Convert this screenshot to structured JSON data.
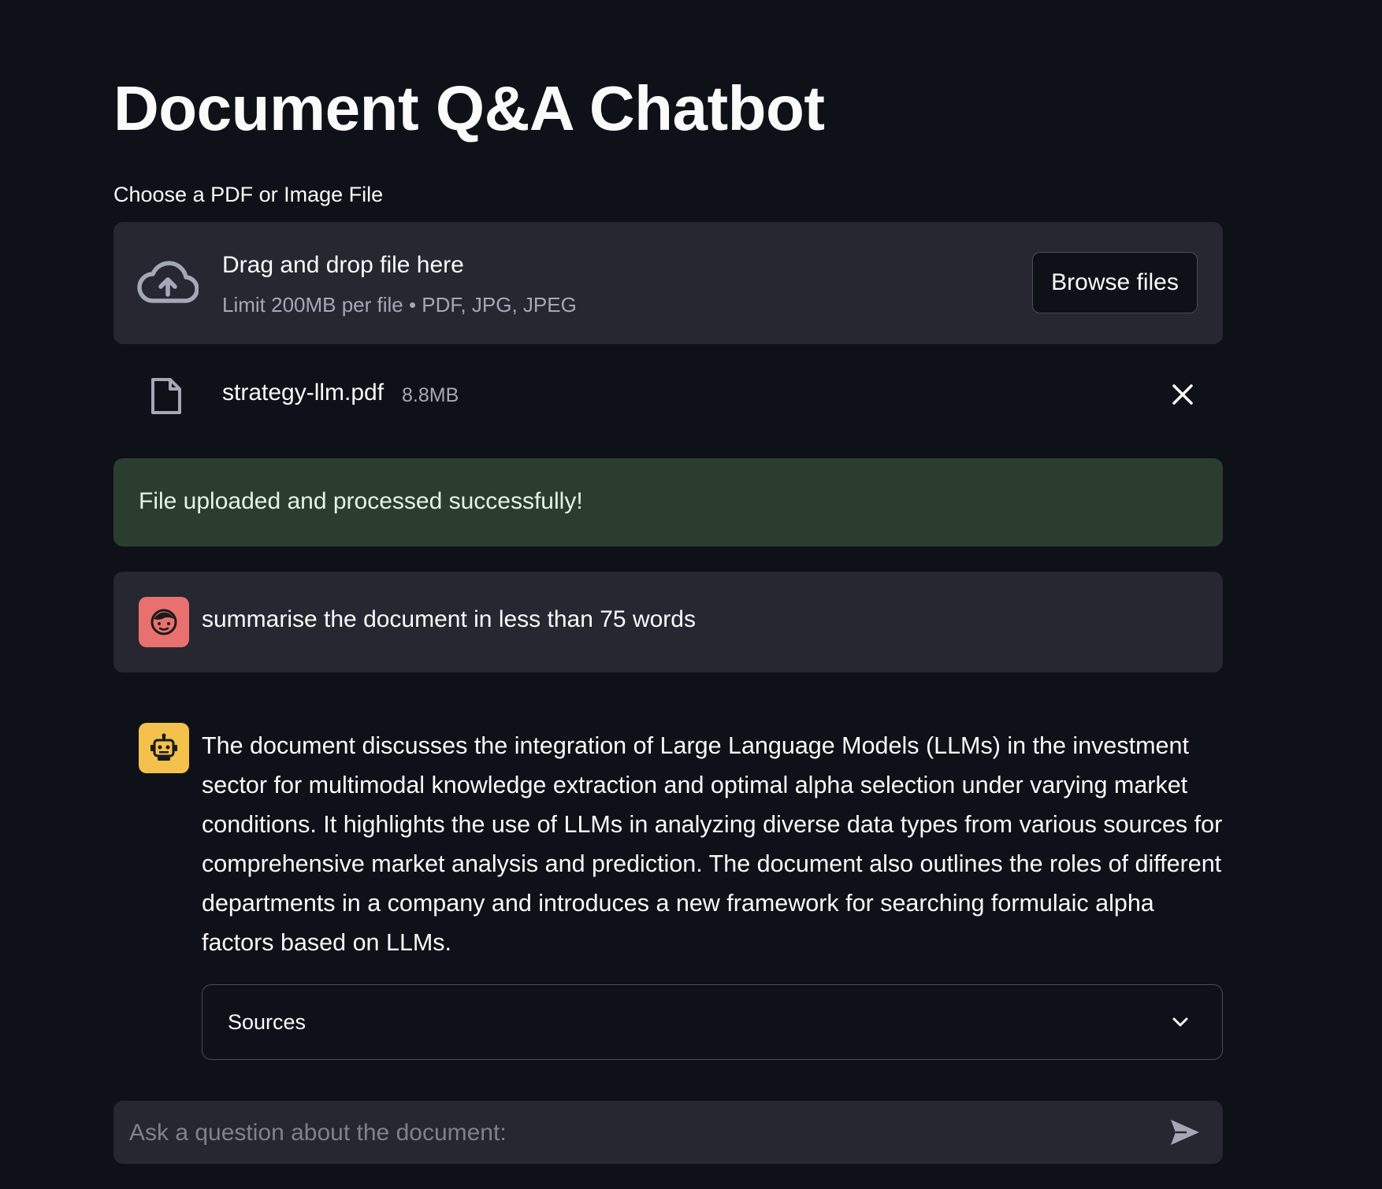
{
  "page": {
    "title": "Document Q&A Chatbot"
  },
  "uploader": {
    "label": "Choose a PDF or Image File",
    "drop_title": "Drag and drop file here",
    "drop_subtitle": "Limit 200MB per file • PDF, JPG, JPEG",
    "browse_label": "Browse files",
    "icon": "cloud-upload-icon"
  },
  "uploaded_file": {
    "name": "strategy-llm.pdf",
    "size": "8.8MB",
    "icon": "file-icon",
    "remove_icon": "close-icon"
  },
  "alert": {
    "message": "File uploaded and processed successfully!",
    "color": "#2b3d2f"
  },
  "messages": [
    {
      "role": "user",
      "avatar": "user-face-icon",
      "avatar_color": "#e8716f",
      "text": "summarise the document in less than 75 words"
    },
    {
      "role": "assistant",
      "avatar": "robot-icon",
      "avatar_color": "#f3c14c",
      "text": "The document discusses the integration of Large Language Models (LLMs) in the investment sector for multimodal knowledge extraction and optimal alpha selection under varying market conditions. It highlights the use of LLMs in analyzing diverse data types from various sources for comprehensive market analysis and prediction. The document also outlines the roles of different departments in a company and introduces a new framework for searching formulaic alpha factors based on LLMs.",
      "expander_label": "Sources"
    }
  ],
  "chat_input": {
    "placeholder": "Ask a question about the document:",
    "send_icon": "send-icon"
  }
}
